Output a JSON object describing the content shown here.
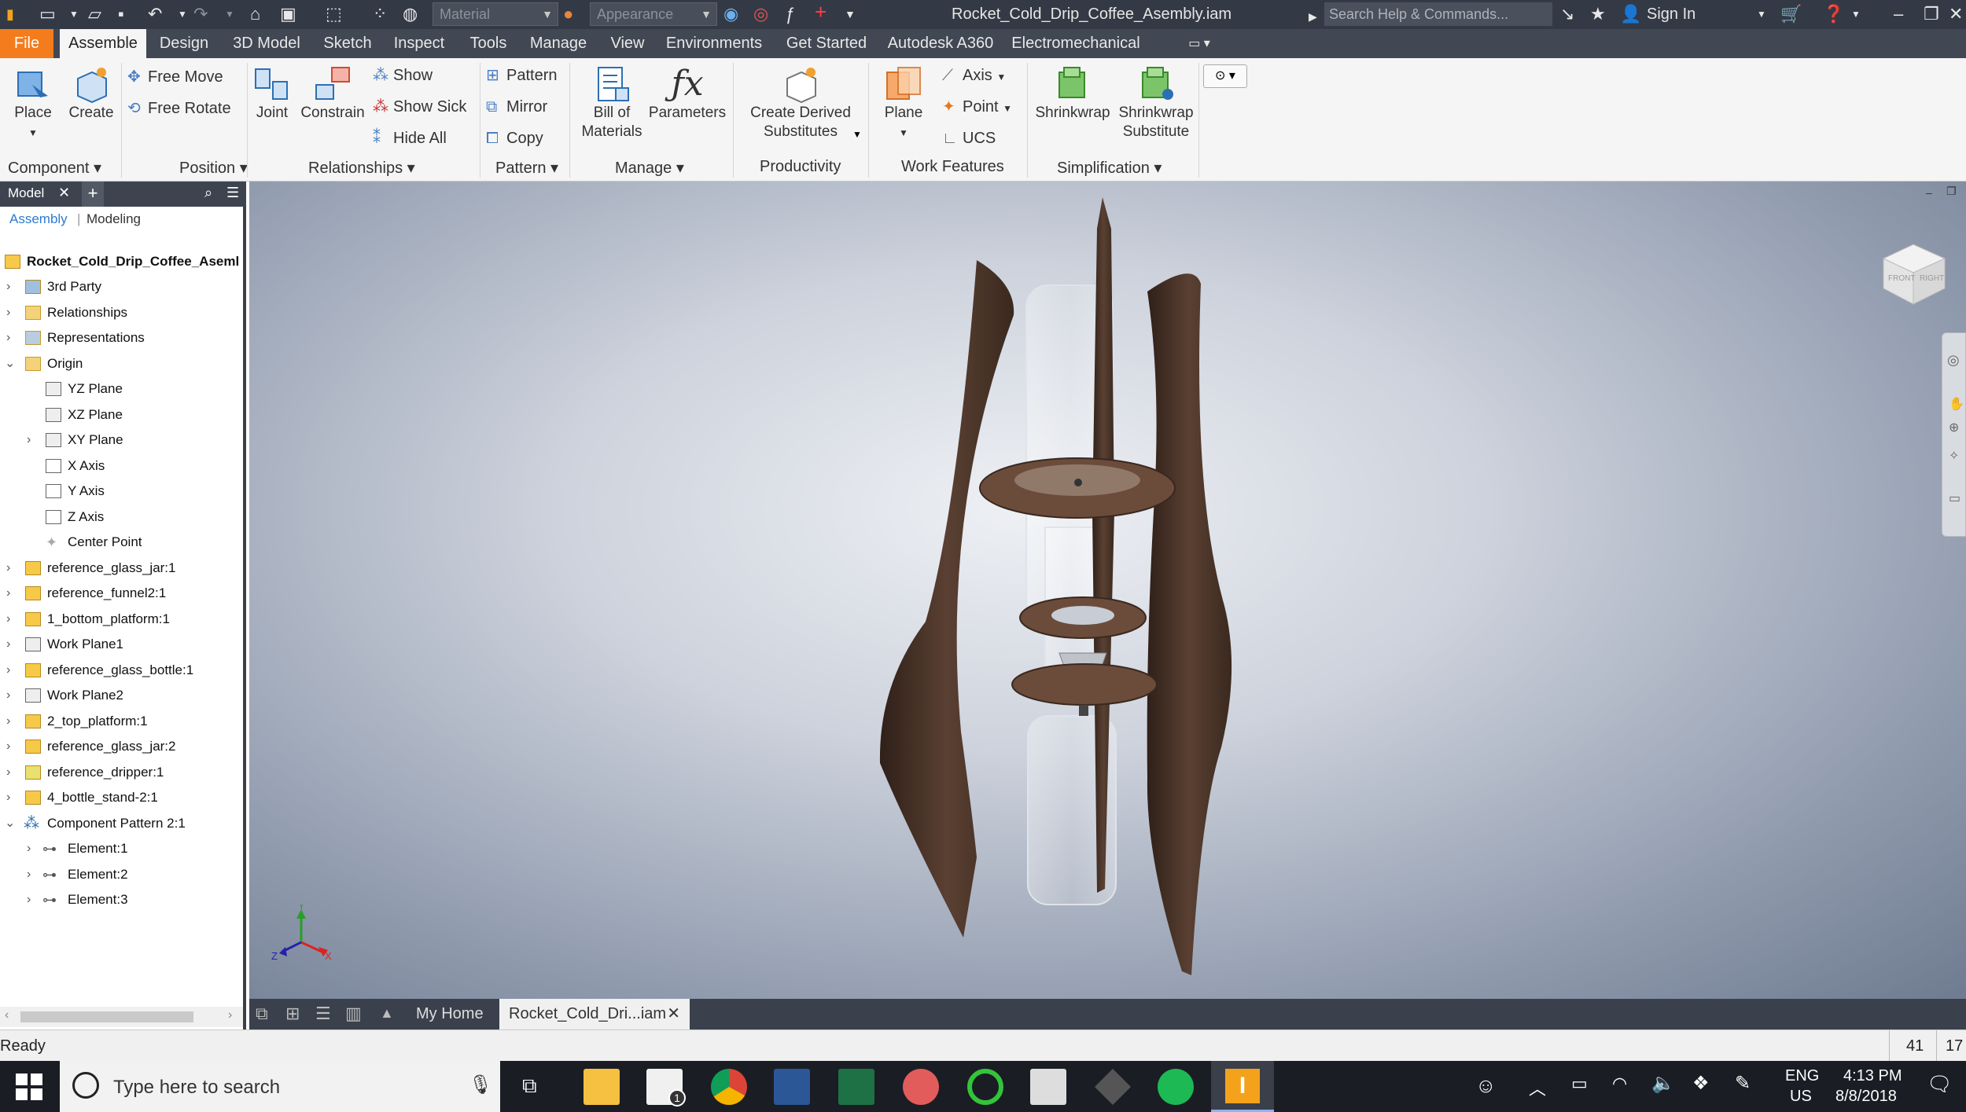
{
  "window": {
    "title": "Rocket_Cold_Drip_Coffee_Asembly.iam",
    "material_placeholder": "Material",
    "appearance_placeholder": "Appearance",
    "search_placeholder": "Search Help & Commands...",
    "sign_in": "Sign In"
  },
  "menu_tabs": [
    "File",
    "Assemble",
    "Design",
    "3D Model",
    "Sketch",
    "Inspect",
    "Tools",
    "Manage",
    "View",
    "Environments",
    "Get Started",
    "Autodesk A360",
    "Electromechanical"
  ],
  "ribbon": {
    "place": "Place",
    "create": "Create",
    "free_move": "Free Move",
    "free_rotate": "Free Rotate",
    "joint": "Joint",
    "constrain": "Constrain",
    "show": "Show",
    "show_sick": "Show Sick",
    "hide_all": "Hide All",
    "pattern": "Pattern",
    "mirror": "Mirror",
    "copy": "Copy",
    "bom_1": "Bill of",
    "bom_2": "Materials",
    "parameters": "Parameters",
    "derived_1": "Create Derived",
    "derived_2": "Substitutes",
    "plane": "Plane",
    "axis": "Axis",
    "point": "Point",
    "ucs": "UCS",
    "shrinkwrap": "Shrinkwrap",
    "shrinkwrap_sub_1": "Shrinkwrap",
    "shrinkwrap_sub_2": "Substitute",
    "groups": {
      "component": "Component",
      "position": "Position",
      "relationships": "Relationships",
      "pattern": "Pattern",
      "manage": "Manage",
      "productivity": "Productivity",
      "work_features": "Work Features",
      "simplification": "Simplification"
    }
  },
  "browser": {
    "tab_label": "Model",
    "sub_assembly": "Assembly",
    "sub_modeling": "Modeling",
    "root": "Rocket_Cold_Drip_Coffee_Aseml",
    "nodes": [
      "3rd Party",
      "Relationships",
      "Representations",
      "Origin",
      "YZ Plane",
      "XZ Plane",
      "XY Plane",
      "X Axis",
      "Y Axis",
      "Z Axis",
      "Center Point",
      "reference_glass_jar:1",
      "reference_funnel2:1",
      "1_bottom_platform:1",
      "Work Plane1",
      "reference_glass_bottle:1",
      "Work Plane2",
      "2_top_platform:1",
      "reference_glass_jar:2",
      "reference_dripper:1",
      "4_bottle_stand-2:1",
      "Component Pattern 2:1",
      "Element:1",
      "Element:2",
      "Element:3"
    ]
  },
  "viewport": {
    "triad_y": "Y",
    "triad_x": "X",
    "triad_z": "Z",
    "viewcube_front": "FRONT",
    "viewcube_right": "RIGHT"
  },
  "doc_tabs": {
    "home": "My Home",
    "active": "Rocket_Cold_Dri...iam"
  },
  "status": {
    "text": "Ready",
    "count1": "41",
    "count2": "17"
  },
  "taskbar": {
    "search": "Type here to search",
    "lang_1": "ENG",
    "lang_2": "US",
    "time": "4:13 PM",
    "date": "8/8/2018",
    "mail_badge": "1"
  },
  "colors": {
    "file_tab": "#f47c1c",
    "titlebar": "#333a45",
    "wood": "#4a3428"
  }
}
